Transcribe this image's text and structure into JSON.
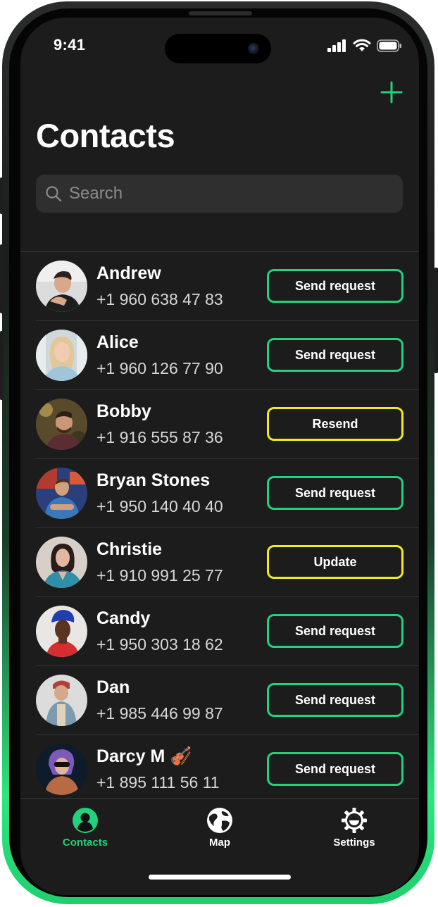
{
  "status_bar": {
    "time": "9:41"
  },
  "header": {
    "title": "Contacts",
    "add_icon": "plus-icon"
  },
  "search": {
    "placeholder": "Search",
    "value": ""
  },
  "contacts": [
    {
      "name": "Andrew",
      "phone": "+1 960 638 47 83",
      "action": "Send request",
      "action_color": "#22d17b"
    },
    {
      "name": "Alice",
      "phone": "+1 960 126 77 90",
      "action": "Send request",
      "action_color": "#22d17b"
    },
    {
      "name": "Bobby",
      "phone": "+1 916 555 87 36",
      "action": "Resend",
      "action_color": "#f2ea1d"
    },
    {
      "name": "Bryan Stones",
      "phone": "+1 950 140 40 40",
      "action": "Send request",
      "action_color": "#22d17b"
    },
    {
      "name": "Christie",
      "phone": "+1 910 991 25 77",
      "action": "Update",
      "action_color": "#f2ea1d"
    },
    {
      "name": "Candy",
      "phone": "+1 950 303 18 62",
      "action": "Send request",
      "action_color": "#22d17b"
    },
    {
      "name": "Dan",
      "phone": "+1 985 446 99 87",
      "action": "Send request",
      "action_color": "#22d17b"
    },
    {
      "name": "Darcy M 🎻",
      "phone": "+1 895 111 56 11",
      "action": "Send request",
      "action_color": "#22d17b"
    }
  ],
  "tabbar": {
    "tabs": [
      {
        "label": "Contacts",
        "icon": "person-icon",
        "active": true
      },
      {
        "label": "Map",
        "icon": "globe-icon",
        "active": false
      },
      {
        "label": "Settings",
        "icon": "gear-icon",
        "active": false
      }
    ]
  },
  "colors": {
    "accent": "#22d17b",
    "warning": "#f2ea1d",
    "background": "#1c1c1c"
  }
}
